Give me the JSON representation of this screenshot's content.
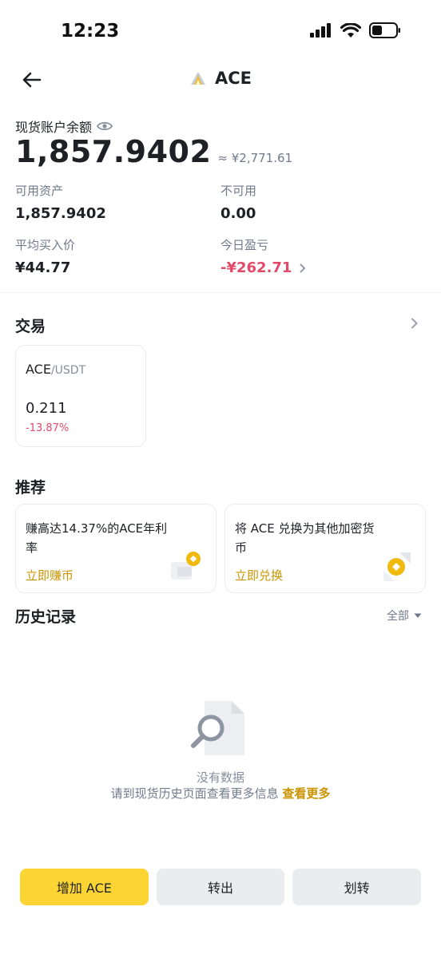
{
  "status_bar": {
    "time": "12:23"
  },
  "header": {
    "title": "ACE"
  },
  "balance": {
    "label": "现货账户余额",
    "value": "1,857.9402",
    "fiat": "≈ ¥2,771.61"
  },
  "stats": {
    "available": {
      "label": "可用资产",
      "value": "1,857.9402"
    },
    "unavailable": {
      "label": "不可用",
      "value": "0.00"
    },
    "avg_price": {
      "label": "平均买入价",
      "value": "¥44.77"
    },
    "today_pnl": {
      "label": "今日盈亏",
      "value": "-¥262.71"
    }
  },
  "trade": {
    "title": "交易",
    "card": {
      "base": "ACE",
      "quote": "/USDT",
      "price": "0.211",
      "change": "-13.87%"
    }
  },
  "recommend": {
    "title": "推荐",
    "earn": {
      "text": "赚高达14.37%的ACE年利率",
      "link": "立即赚币"
    },
    "convert": {
      "text": "将 ACE 兑换为其他加密货币",
      "link": "立即兑换"
    }
  },
  "history": {
    "title": "历史记录",
    "filter": "全部",
    "empty_title": "没有数据",
    "empty_desc": "请到现货历史页面查看更多信息",
    "empty_link": "查看更多"
  },
  "actions": {
    "deposit": "增加 ACE",
    "withdraw": "转出",
    "transfer": "划转"
  },
  "colors": {
    "accent": "#fcd535",
    "link": "#c99400",
    "negative": "#e24a6a",
    "muted": "#707a8a"
  }
}
